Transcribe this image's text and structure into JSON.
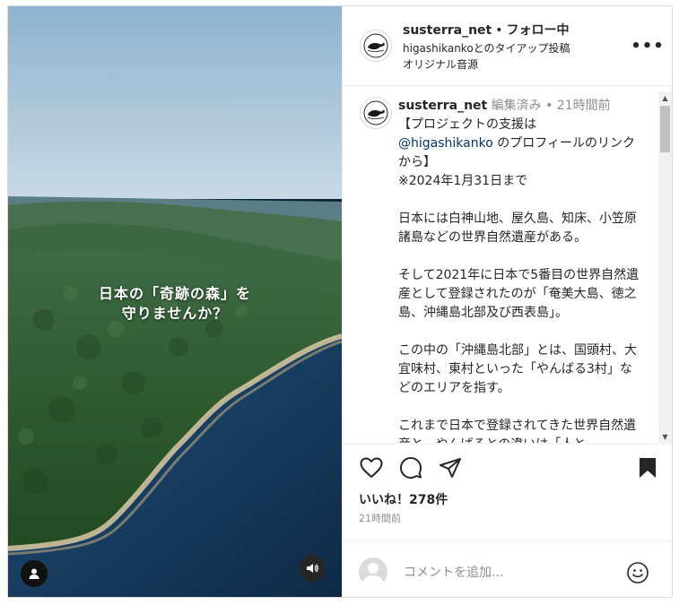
{
  "media": {
    "overlay_line1": "日本の「奇跡の森」を",
    "overlay_line2": "守りませんか？",
    "user_tag_icon": "user-icon",
    "mute_icon": "speaker-icon"
  },
  "header": {
    "username": "susterra_net",
    "separator": "•",
    "follow_label": "フォロー中",
    "partnership_text": "higashikankoとのタイアップ投稿",
    "audio_text": "オリジナル音源",
    "more_icon": "more-horizontal-icon",
    "more_label": "•••"
  },
  "caption": {
    "username": "susterra_net",
    "edited_label": "編集済み",
    "dot": "•",
    "time_label": "21時間前",
    "line1": "【プロジェクトの支援は",
    "mention": "@higashikanko",
    "line2_after_mention": " のプロフィールのリンクから】",
    "line3": "※2024年1月31日まで",
    "para1": "日本には白神山地、屋久島、知床、小笠原諸島などの世界自然遺産がある。",
    "para2": "そして2021年に日本で5番目の世界自然遺産として登録されたのが「奄美大島、徳之島、沖縄島北部及び西表島」。",
    "para3": "この中の「沖縄島北部」とは、国頭村、大宜味村、東村といった「やんばる3村」などのエリアを指す。",
    "para4": "これまで日本で登録されてきた世界自然遺産と、やんばるとの違いは「人と"
  },
  "scrollbar": {
    "up_glyph": "▲",
    "down_glyph": "▼"
  },
  "actions": {
    "like_icon": "heart-icon",
    "comment_icon": "comment-icon",
    "share_icon": "send-icon",
    "save_icon": "bookmark-icon"
  },
  "likes_text": "いいね！278件",
  "time_ago": "21時間前",
  "comment": {
    "placeholder": "コメントを追加...",
    "emoji_icon": "emoji-icon"
  },
  "colors": {
    "mention": "#00376b",
    "muted": "#8e8e8e",
    "text": "#262626"
  }
}
